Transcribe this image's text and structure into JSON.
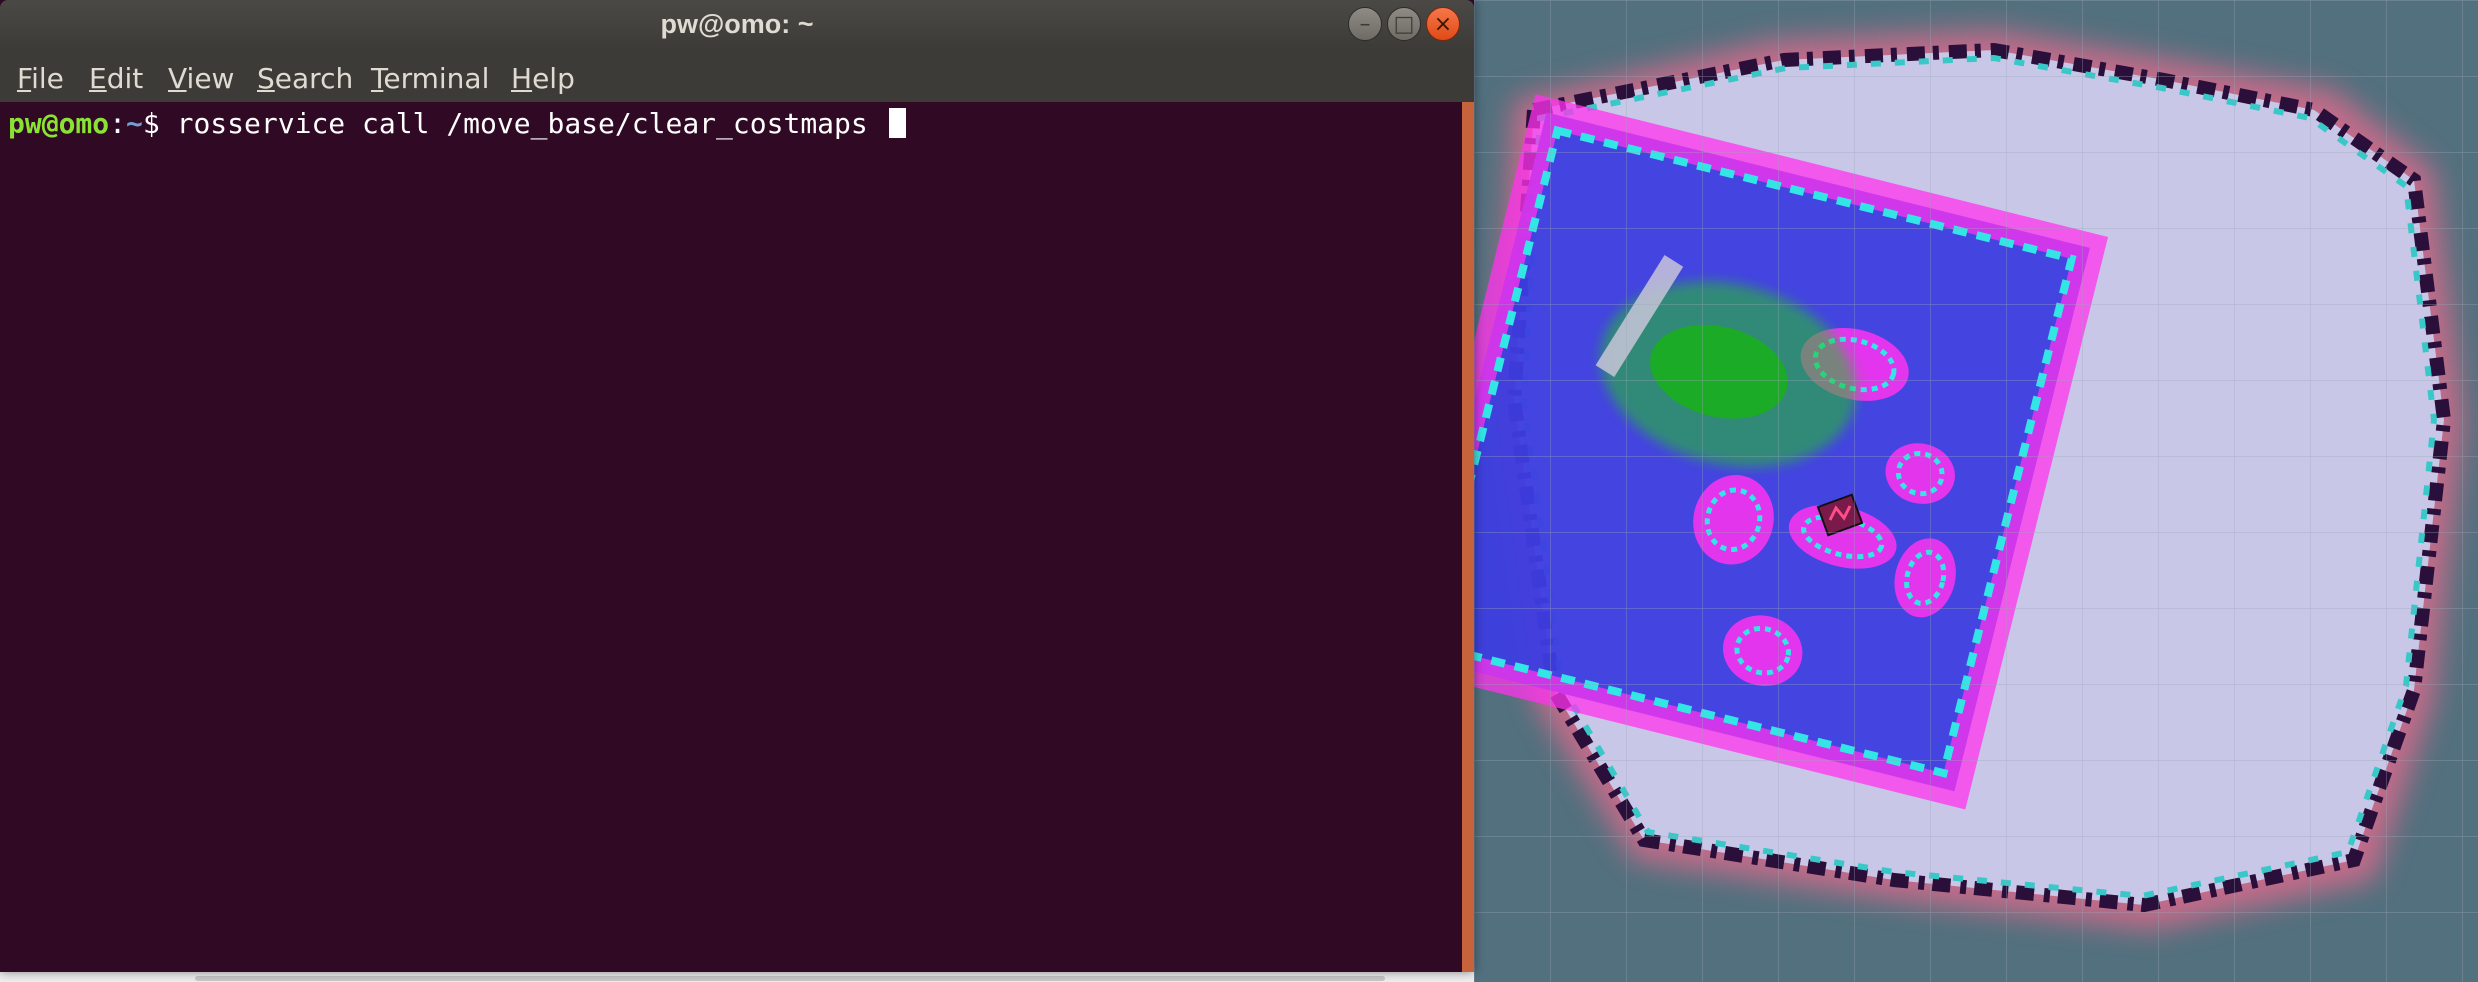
{
  "terminal": {
    "title": "pw@omo: ~",
    "buttons": {
      "minimize": "–",
      "maximize": "□",
      "close": "×"
    },
    "menu": [
      {
        "mnemonic": "F",
        "rest": "ile"
      },
      {
        "mnemonic": "E",
        "rest": "dit"
      },
      {
        "mnemonic": "V",
        "rest": "iew"
      },
      {
        "mnemonic": "S",
        "rest": "earch"
      },
      {
        "mnemonic": "T",
        "rest": "erminal"
      },
      {
        "mnemonic": "H",
        "rest": "elp"
      }
    ],
    "prompt": {
      "user_host": "pw@omo",
      "separator": ":",
      "path": "~",
      "symbol": "$ ",
      "command": "rosservice call /move_base/clear_costmaps "
    }
  },
  "colors": {
    "terminal_bg": "#300a24",
    "prompt_user": "#8ae234",
    "prompt_path": "#729fcf",
    "titlebar": "#3c3b37",
    "close_button": "#e95420",
    "map_unknown": "#4f6a8c",
    "map_free": "#c8c6e6",
    "costmap_free": "#3d3de0",
    "costmap_inflated": "#ff33ee",
    "costmap_lethal": "#33e6e6",
    "wall": "#2a0f3a",
    "laser_points": "#22c422",
    "robot": "#e0306a"
  },
  "rviz": {
    "view": "map-with-costmap",
    "icons": [
      "robot-footprint-icon"
    ]
  }
}
